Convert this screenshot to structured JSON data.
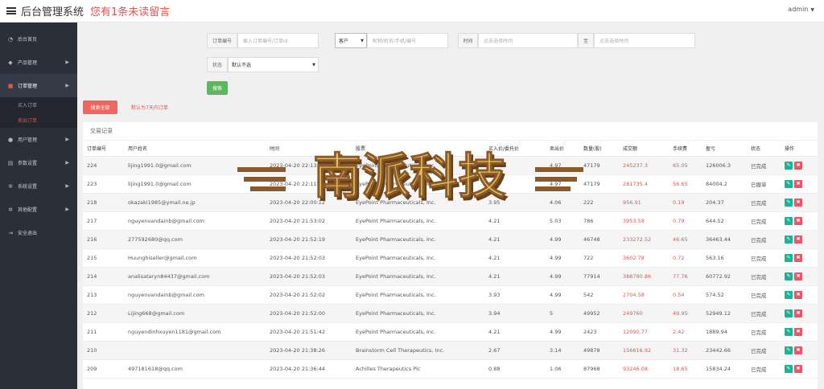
{
  "header": {
    "title": "后台管理系统",
    "unread": "您有1条未读留言",
    "user": "admin"
  },
  "sidebar": {
    "items": [
      {
        "label": "后台首页",
        "icon": "dashboard-icon"
      },
      {
        "label": "产品管理",
        "icon": "tag-icon"
      },
      {
        "label": "订单管理",
        "icon": "book-icon",
        "active": true
      },
      {
        "label": "用户管理",
        "icon": "user-icon"
      },
      {
        "label": "参数设置",
        "icon": "document-icon"
      },
      {
        "label": "系统设置",
        "icon": "gear-icon"
      },
      {
        "label": "其他配置",
        "icon": "gear-small-icon"
      },
      {
        "label": "安全退出",
        "icon": "logout-icon"
      }
    ],
    "sub_items": [
      "买入订单",
      "卖出订单"
    ]
  },
  "filters": {
    "order_no_label": "订单编号",
    "order_no_placeholder": "输入订单编号/订单id",
    "user_select": "客户",
    "user_placeholder": "昵称/姓名/手机/编号",
    "time_label": "时间",
    "time_placeholder": "点击选择时间",
    "to_label": "至",
    "time_end_placeholder": "点击选择时间",
    "status_label": "状态",
    "status_value": "默认不选",
    "search_button": "搜索",
    "search_all_button": "搜索全部",
    "default_note": "默认为7天内订单"
  },
  "table": {
    "title": "交易记录",
    "columns": [
      "订单编号",
      "用户姓名",
      "时间",
      "股票",
      "买入价/委托价",
      "卖出价",
      "数量(股)",
      "成交额",
      "手续费",
      "盈亏",
      "状态",
      "操作"
    ],
    "rows": [
      [
        "224",
        "lijing1991.0@gmail.com",
        "2023-04-20 22:13:22",
        "EyePoint Pharmaceuticals, Inc.",
        "5.36",
        "4.97",
        "47179",
        "245237.3",
        "65.05",
        "126006.3",
        "已完成"
      ],
      [
        "223",
        "lijing1991.0@gmail.com",
        "2023-04-20 22:11:25",
        "EyePoint Pharmaceuticals, Inc.",
        "5.3",
        "4.97",
        "47179",
        "281735.4",
        "56.65",
        "84004.2",
        "已撤单"
      ],
      [
        "218",
        "okazaki1985@ymail.ne.jp",
        "2023-04-20 22:00:12",
        "EyePoint Pharmaceuticals, Inc.",
        "3.95",
        "4.06",
        "222",
        "956.91",
        "0.19",
        "204.37",
        "已完成"
      ],
      [
        "217",
        "nguyenvandainb@gmail.com",
        "2023-04-20 21:53:02",
        "EyePoint Pharmaceuticals, Inc.",
        "4.21",
        "5.03",
        "786",
        "3953.58",
        "0.79",
        "644.52",
        "已完成"
      ],
      [
        "216",
        "277592680@qq.com",
        "2023-04-20 21:52:19",
        "EyePoint Pharmaceuticals, Inc.",
        "4.21",
        "4.99",
        "46748",
        "233272.52",
        "46.65",
        "36463.44",
        "已完成"
      ],
      [
        "215",
        "Huunghiseller@gmail.com",
        "2023-04-20 21:52:03",
        "EyePoint Pharmaceuticals, Inc.",
        "4.21",
        "4.99",
        "722",
        "3602.78",
        "0.72",
        "563.16",
        "已完成"
      ],
      [
        "214",
        "analisataryn84437@gmail.com",
        "2023-04-20 21:52:03",
        "EyePoint Pharmaceuticals, Inc.",
        "4.21",
        "4.99",
        "77914",
        "388790.86",
        "77.76",
        "60772.92",
        "已完成"
      ],
      [
        "213",
        "nguyenvandainb@gmail.com",
        "2023-04-20 21:52:02",
        "EyePoint Pharmaceuticals, Inc.",
        "3.93",
        "4.99",
        "542",
        "2704.58",
        "0.54",
        "574.52",
        "已完成"
      ],
      [
        "212",
        "Lijing668@gmail.com",
        "2023-04-20 21:52:00",
        "EyePoint Pharmaceuticals, Inc.",
        "3.94",
        "5",
        "49952",
        "249760",
        "49.95",
        "52949.12",
        "已完成"
      ],
      [
        "211",
        "nguyendinhxuyen1181@gmail.com",
        "2023-04-20 21:51:42",
        "EyePoint Pharmaceuticals, Inc.",
        "4.21",
        "4.99",
        "2423",
        "12090.77",
        "2.42",
        "1889.94",
        "已完成"
      ],
      [
        "210",
        "",
        "2023-04-20 21:38:26",
        "Brainstorm Cell Therapeutics, Inc.",
        "2.67",
        "3.14",
        "49878",
        "156616.92",
        "31.32",
        "23442.66",
        "已完成"
      ],
      [
        "209",
        "497181618@qq.com",
        "2023-04-20 21:36:44",
        "Achilles Therapeutics Plc",
        "0.88",
        "1.06",
        "87968",
        "93246.08",
        "18.65",
        "15834.24",
        "已完成"
      ]
    ]
  },
  "watermark": "南派科技"
}
